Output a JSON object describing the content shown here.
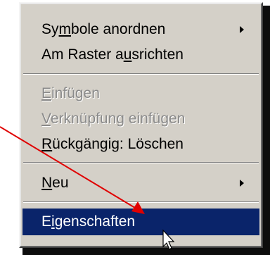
{
  "menu": {
    "items": [
      {
        "pre": "Sy",
        "u": "m",
        "post": "bole anordnen"
      },
      {
        "pre": "Am Raster a",
        "u": "u",
        "post": "srichten"
      },
      {
        "pre": "",
        "u": "E",
        "post": "infügen"
      },
      {
        "pre": "",
        "u": "V",
        "post": "erknüpfung einfügen"
      },
      {
        "pre": "",
        "u": "R",
        "post": "ückgängig: Löschen"
      },
      {
        "pre": "",
        "u": "N",
        "post": "eu"
      },
      {
        "pre": "E",
        "u": "i",
        "post": "genschaften"
      }
    ]
  },
  "colors": {
    "menu_background": "#d4d0c8",
    "highlight_background": "#0a246a",
    "highlight_text": "#ffffff",
    "disabled_text": "#8a8a8a",
    "annotation_arrow": "#e00000"
  },
  "icons": {
    "submenu_arrow": "chevron-right-icon",
    "cursor": "mouse-pointer-icon",
    "annotation": "red-arrow-icon"
  }
}
